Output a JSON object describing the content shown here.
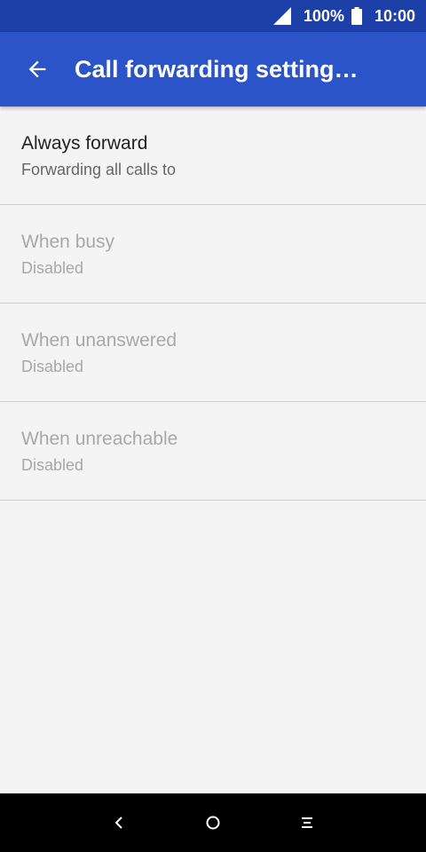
{
  "status_bar": {
    "battery": "100%",
    "time": "10:00",
    "icons": [
      "signal-icon",
      "battery-icon"
    ]
  },
  "app_bar": {
    "title": "Call forwarding setting…",
    "back_icon": "arrow-back-icon"
  },
  "items": [
    {
      "title": "Always forward",
      "subtitle": "Forwarding all calls to",
      "enabled": true
    },
    {
      "title": "When busy",
      "subtitle": "Disabled",
      "enabled": false
    },
    {
      "title": "When unanswered",
      "subtitle": "Disabled",
      "enabled": false
    },
    {
      "title": "When unreachable",
      "subtitle": "Disabled",
      "enabled": false
    }
  ],
  "nav_bar": {
    "icons": [
      "nav-back-icon",
      "nav-home-icon",
      "nav-recents-icon"
    ]
  },
  "colors": {
    "status_bar": "#1c3fa8",
    "app_bar": "#2a54c8",
    "background": "#f4f4f4"
  }
}
